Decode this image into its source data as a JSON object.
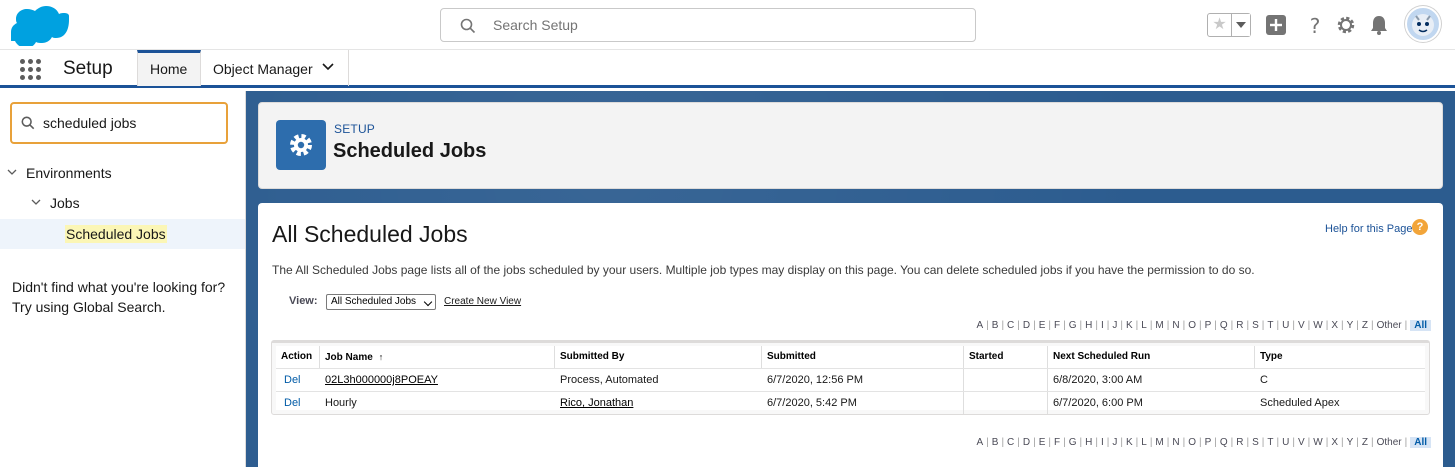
{
  "header": {
    "search_placeholder": "Search Setup",
    "icons": [
      "favorites-star-icon",
      "add-icon",
      "help-icon",
      "gear-icon",
      "bell-icon",
      "avatar"
    ]
  },
  "nav": {
    "app_name": "Setup",
    "tabs": [
      {
        "label": "Home"
      },
      {
        "label": "Object Manager"
      }
    ]
  },
  "sidebar": {
    "quick_find_value": "scheduled jobs",
    "tree": [
      {
        "label": "Environments"
      },
      {
        "label": "Jobs"
      },
      {
        "label": "Scheduled Jobs"
      }
    ],
    "not_found": "Didn't find what you're looking for? Try using Global Search."
  },
  "page_header": {
    "breadcrumb": "SETUP",
    "title": "Scheduled Jobs"
  },
  "content": {
    "title": "All Scheduled Jobs",
    "help_link": "Help for this Page",
    "help_icon_text": "?",
    "description": "The All Scheduled Jobs page lists all of the jobs scheduled by your users. Multiple job types may display on this page. You can delete scheduled jobs if you have the permission to do so.",
    "view_label": "View:",
    "view_selected": "All Scheduled Jobs",
    "create_new_view": "Create New View",
    "alpha": [
      "A",
      "B",
      "C",
      "D",
      "E",
      "F",
      "G",
      "H",
      "I",
      "J",
      "K",
      "L",
      "M",
      "N",
      "O",
      "P",
      "Q",
      "R",
      "S",
      "T",
      "U",
      "V",
      "W",
      "X",
      "Y",
      "Z",
      "Other",
      "All"
    ],
    "table": {
      "columns": [
        "Action",
        "Job Name",
        "Submitted By",
        "Submitted",
        "Started",
        "Next Scheduled Run",
        "Type"
      ],
      "sort_indicator": "↑",
      "rows": [
        {
          "action": "Del",
          "job_name": "02L3h000000j8POEAY",
          "submitted_by": "Process, Automated",
          "submitted": "6/7/2020, 12:56 PM",
          "started": "",
          "next_run": "6/8/2020, 3:00 AM",
          "type": "C"
        },
        {
          "action": "Del",
          "job_name": "Hourly",
          "submitted_by": "Rico, Jonathan",
          "submitted": "6/7/2020, 5:42 PM",
          "started": "",
          "next_run": "6/7/2020, 6:00 PM",
          "type": "Scheduled Apex"
        }
      ]
    }
  },
  "colors": {
    "brand_blue": "#1b5297",
    "link_blue": "#015ba7",
    "highlight": "#fbf6b6",
    "focus_orange": "#e8a13a"
  }
}
